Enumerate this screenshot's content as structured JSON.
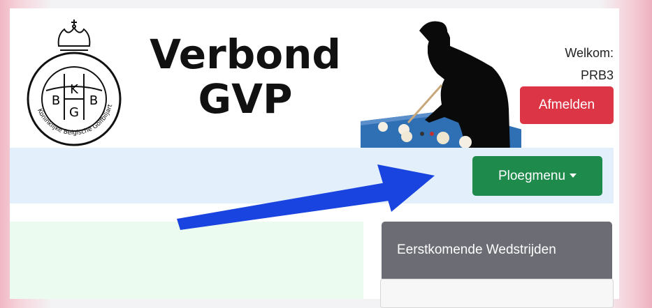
{
  "header": {
    "logo": {
      "letters": [
        "K",
        "B",
        "B",
        "G"
      ],
      "ring_text": "Koninklijke Belgische Golfbiljartbond"
    },
    "title_line1": "Verbond",
    "title_line2": "GVP",
    "welcome_label": "Welkom:",
    "username": "PRB3",
    "logout_label": "Afmelden"
  },
  "nav": {
    "team_menu_label": "Ploegmenu"
  },
  "sidebar": {
    "upcoming_title": "Eerstkomende Wedstrijden"
  },
  "colors": {
    "logout": "#dc3545",
    "team_menu": "#1e8a4c",
    "navbar": "#e3f0fb",
    "annotation_arrow": "#1a44e0"
  }
}
